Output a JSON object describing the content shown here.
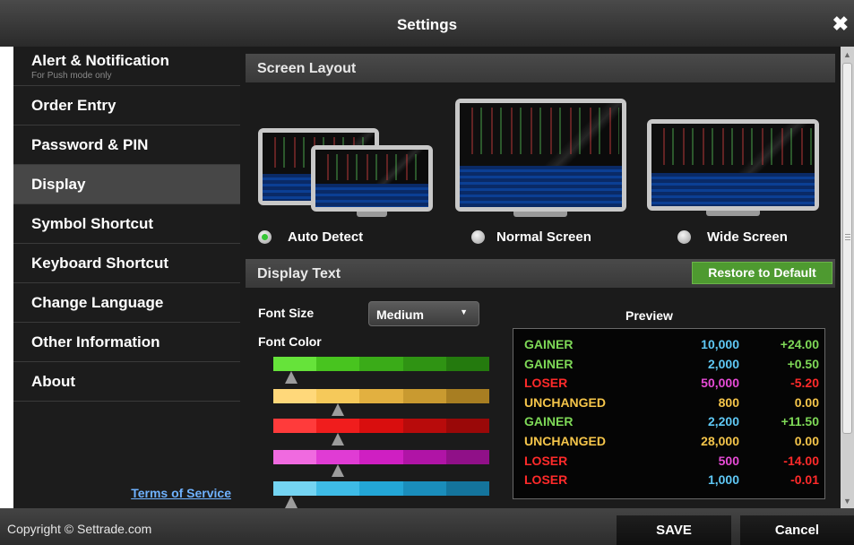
{
  "window": {
    "title": "Settings",
    "close_icon": "close-icon"
  },
  "sidebar": {
    "items": [
      {
        "label": "Alert & Notification",
        "sub": "For Push mode only"
      },
      {
        "label": "Order Entry"
      },
      {
        "label": "Password & PIN"
      },
      {
        "label": "Display",
        "active": true
      },
      {
        "label": "Symbol Shortcut"
      },
      {
        "label": "Keyboard Shortcut"
      },
      {
        "label": "Change Language"
      },
      {
        "label": "Other Information"
      },
      {
        "label": "About"
      }
    ],
    "terms_link": "Terms of Service"
  },
  "screen_layout": {
    "heading": "Screen Layout",
    "options": [
      {
        "label": "Auto Detect",
        "selected": true
      },
      {
        "label": "Normal Screen",
        "selected": false
      },
      {
        "label": "Wide Screen",
        "selected": false
      }
    ]
  },
  "display_text": {
    "heading": "Display Text",
    "restore_button": "Restore to Default",
    "font_size_label": "Font Size",
    "font_size_value": "Medium",
    "font_color_label": "Font Color",
    "color_sliders": [
      {
        "name": "gainer",
        "colors": [
          "#66e33a",
          "#48c41f",
          "#3aab18",
          "#2f9313",
          "#247a0e"
        ],
        "selected_index": 0
      },
      {
        "name": "unchanged",
        "colors": [
          "#ffd87a",
          "#f6c95a",
          "#e2b040",
          "#c99a30",
          "#a87e22"
        ],
        "selected_index": 1
      },
      {
        "name": "loser",
        "colors": [
          "#ff3b3b",
          "#f01d1d",
          "#d90e0e",
          "#b80b0b",
          "#9a0808"
        ],
        "selected_index": 1
      },
      {
        "name": "volume",
        "colors": [
          "#f06ae0",
          "#e03cd4",
          "#cf1fc2",
          "#b014a6",
          "#901088"
        ],
        "selected_index": 1
      },
      {
        "name": "value",
        "colors": [
          "#74d4f2",
          "#3ebbe6",
          "#23a6d6",
          "#1a8dbb",
          "#14749c"
        ],
        "selected_index": 0
      }
    ]
  },
  "preview": {
    "heading": "Preview",
    "rows": [
      {
        "status": "GAINER",
        "volume": "10,000",
        "change": "+24.00",
        "status_color": "#7ed957",
        "volume_color": "#5fc8f5",
        "change_color": "#7ed957"
      },
      {
        "status": "GAINER",
        "volume": "2,000",
        "change": "+0.50",
        "status_color": "#7ed957",
        "volume_color": "#5fc8f5",
        "change_color": "#7ed957"
      },
      {
        "status": "LOSER",
        "volume": "50,000",
        "change": "-5.20",
        "status_color": "#ff2a2a",
        "volume_color": "#e64bd6",
        "change_color": "#ff2a2a"
      },
      {
        "status": "UNCHANGED",
        "volume": "800",
        "change": "0.00",
        "status_color": "#f5c54a",
        "volume_color": "#f5c54a",
        "change_color": "#f5c54a"
      },
      {
        "status": "GAINER",
        "volume": "2,200",
        "change": "+11.50",
        "status_color": "#7ed957",
        "volume_color": "#5fc8f5",
        "change_color": "#7ed957"
      },
      {
        "status": "UNCHANGED",
        "volume": "28,000",
        "change": "0.00",
        "status_color": "#f5c54a",
        "volume_color": "#f5c54a",
        "change_color": "#f5c54a"
      },
      {
        "status": "LOSER",
        "volume": "500",
        "change": "-14.00",
        "status_color": "#ff2a2a",
        "volume_color": "#e64bd6",
        "change_color": "#ff2a2a"
      },
      {
        "status": "LOSER",
        "volume": "1,000",
        "change": "-0.01",
        "status_color": "#ff2a2a",
        "volume_color": "#5fc8f5",
        "change_color": "#ff2a2a"
      }
    ]
  },
  "footer": {
    "copyright": "Copyright © Settrade.com",
    "save_button": "SAVE",
    "cancel_button": "Cancel"
  }
}
